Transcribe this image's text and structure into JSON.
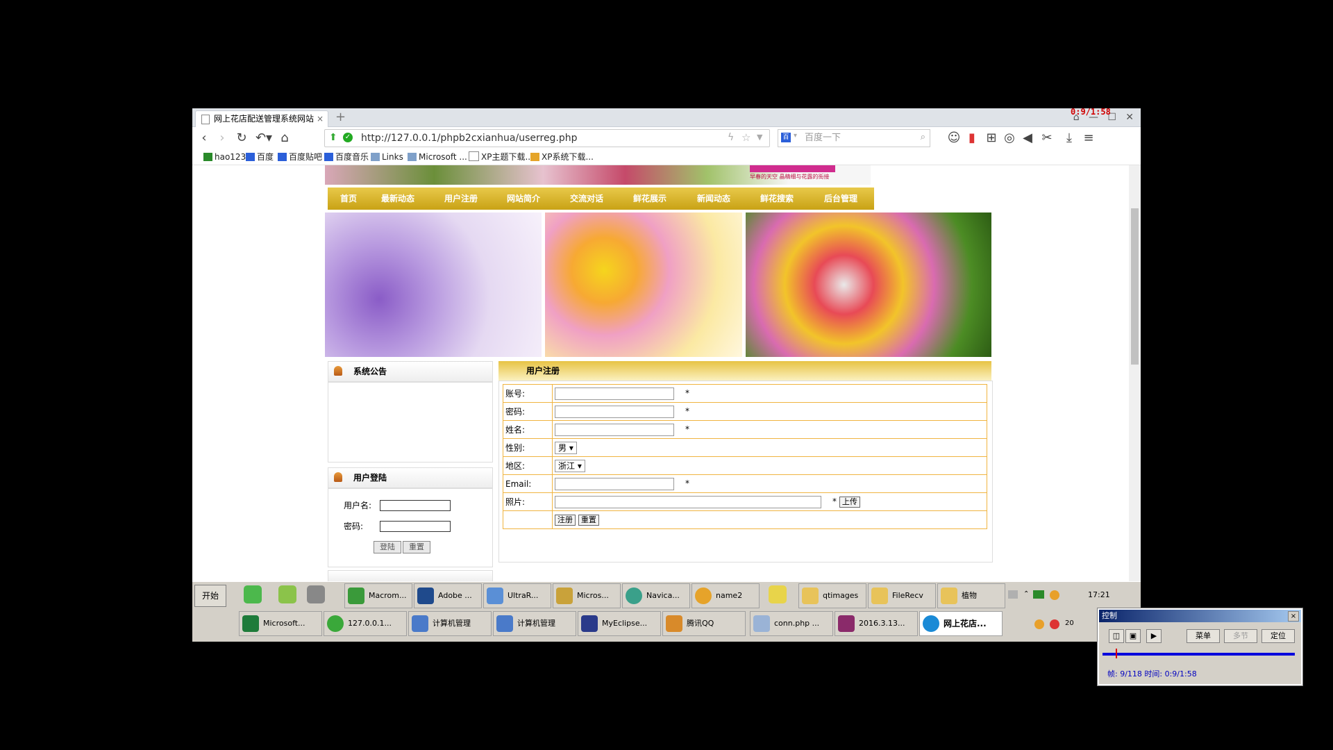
{
  "browser": {
    "tab_title": "网上花店配送管理系统网站",
    "tab_close": "×",
    "new_tab": "+",
    "url": "http://127.0.0.1/phpb2cxianhua/userreg.php",
    "search_placeholder": "百度一下",
    "bookmarks": [
      "hao123",
      "百度",
      "百度贴吧",
      "百度音乐",
      "Links",
      "Microsoft ...",
      "XP主题下载...",
      "XP系统下载..."
    ]
  },
  "page": {
    "banner_text": "早春的天空 晶精细与花露的街接",
    "menu": [
      "首页",
      "最新动态",
      "用户注册",
      "网站简介",
      "交流对话",
      "鲜花展示",
      "新闻动态",
      "鲜花搜索",
      "后台管理"
    ],
    "notice_title": "系统公告",
    "login": {
      "title": "用户登陆",
      "username_label": "用户名:",
      "password_label": "密码:",
      "login_button": "登陆",
      "reset_button": "重置"
    },
    "register": {
      "title": "用户注册",
      "account_label": "账号:",
      "password_label": "密码:",
      "name_label": "姓名:",
      "gender_label": "性别:",
      "gender_value": "男",
      "region_label": "地区:",
      "region_value": "浙江",
      "email_label": "Email:",
      "photo_label": "照片:",
      "required_mark": "*",
      "upload_button": "上传",
      "submit_button": "注册",
      "reset_button": "重置"
    }
  },
  "taskbar": {
    "start_label": "开始",
    "row1": [
      "Macrom...",
      "Adobe ...",
      "UltraR...",
      "Micros...",
      "Navica...",
      "name2",
      "qtimages",
      "FileRecv",
      "植物"
    ],
    "row2": [
      "Microsoft...",
      "127.0.0.1...",
      "计算机管理",
      "计算机管理",
      "MyEclipse...",
      "腾讯QQ",
      "conn.php ...",
      "2016.3.13...",
      "网上花店..."
    ],
    "clock": "17:21",
    "tray_year": "20"
  },
  "recorder": {
    "title": "控制",
    "close": "×",
    "menu_button": "菜单",
    "section_button": "多节",
    "locate_button": "定位",
    "status": "帧: 9/118 时间: 0:9/1:58",
    "overlay_time": "0:9/1:58"
  }
}
